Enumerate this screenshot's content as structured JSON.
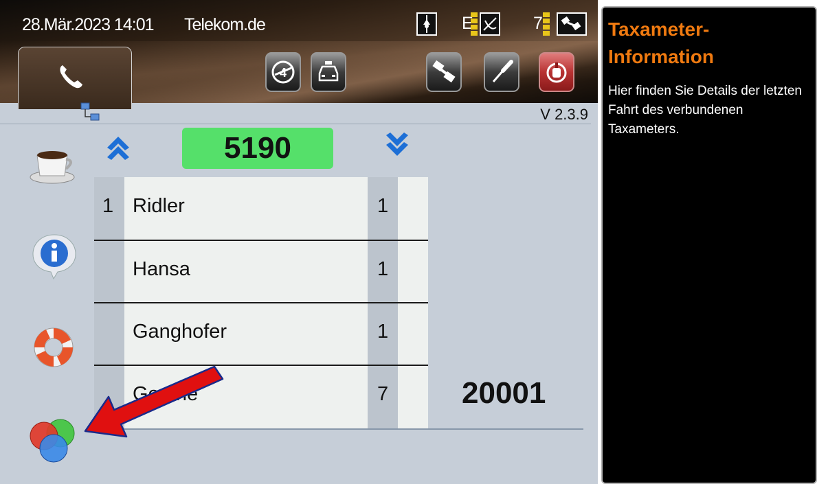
{
  "status_bar": {
    "datetime": "28.Mär.2023 14:01",
    "carrier": "Telekom.de",
    "network_letter": "E",
    "satellite_count": "7"
  },
  "header": {
    "version": "V 2.3.9"
  },
  "queue": {
    "number": "5190",
    "rows": [
      {
        "pos": "1",
        "name": "Ridler",
        "count": "1"
      },
      {
        "pos": "",
        "name": "Hansa",
        "count": "1"
      },
      {
        "pos": "",
        "name": "Ganghofer",
        "count": "1"
      },
      {
        "pos": "",
        "name": "Goethe",
        "count": "7"
      }
    ],
    "total": "20001"
  },
  "info_panel": {
    "title": "Taxameter-Information",
    "body": "Hier finden Sie Details der letzten Fahrt des verbundenen Taxameters."
  },
  "colors": {
    "accent_orange": "#f07a10",
    "counter_green": "#55e06a",
    "chevron_blue": "#1d6fd6",
    "annotation_arrow": "#e01010"
  },
  "icons": [
    "phone-icon",
    "taxi-sign-icon",
    "taxi-car-icon",
    "satellite-icon",
    "screwdriver-icon",
    "power-icon",
    "network-icon",
    "coffee-icon",
    "info-icon",
    "lifebuoy-icon",
    "color-circles-icon",
    "chevron-up-icon",
    "chevron-down-icon"
  ]
}
